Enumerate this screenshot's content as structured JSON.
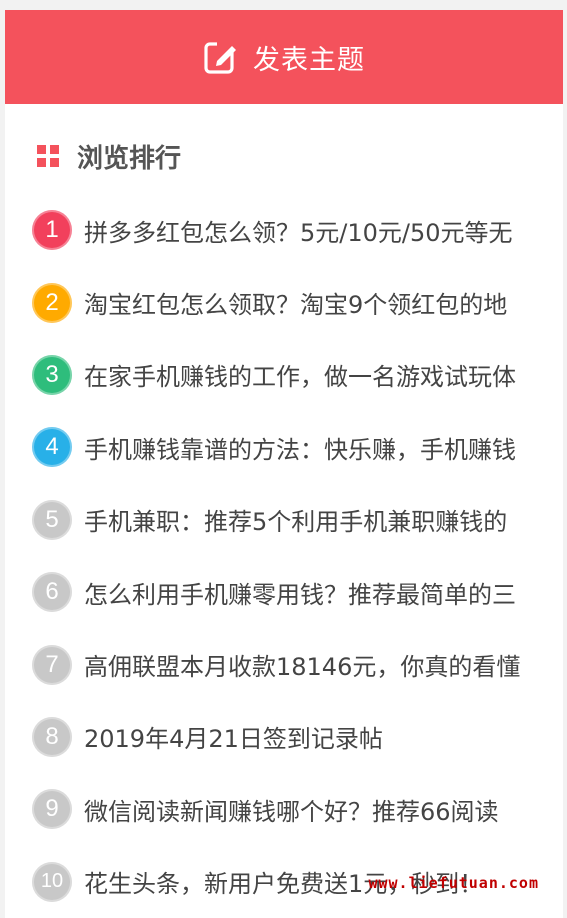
{
  "post_button": {
    "label": "发表主题",
    "icon": "edit-icon",
    "color": "#f4525c"
  },
  "panel": {
    "title": "浏览排行",
    "title_icon": "grid-icon"
  },
  "rank_colors": {
    "1": "#f2405c",
    "2": "#ffaa00",
    "3": "#2ebd7c",
    "4": "#28b0e8",
    "default": "#c8c8c8"
  },
  "ranking": [
    {
      "rank": "1",
      "title": "拼多多红包怎么领？5元/10元/50元等无"
    },
    {
      "rank": "2",
      "title": "淘宝红包怎么领取？淘宝9个领红包的地"
    },
    {
      "rank": "3",
      "title": "在家手机赚钱的工作，做一名游戏试玩体"
    },
    {
      "rank": "4",
      "title": "手机赚钱靠谱的方法：快乐赚，手机赚钱"
    },
    {
      "rank": "5",
      "title": "手机兼职：推荐5个利用手机兼职赚钱的"
    },
    {
      "rank": "6",
      "title": "怎么利用手机赚零用钱？推荐最简单的三"
    },
    {
      "rank": "7",
      "title": "高佣联盟本月收款18146元，你真的看懂"
    },
    {
      "rank": "8",
      "title": "2019年4月21日签到记录帖"
    },
    {
      "rank": "9",
      "title": "微信阅读新闻赚钱哪个好？推荐66阅读"
    },
    {
      "rank": "10",
      "title": "花生头条，新用户免费送1元，秒到！"
    }
  ],
  "watermark": "www.liefutuan.com"
}
